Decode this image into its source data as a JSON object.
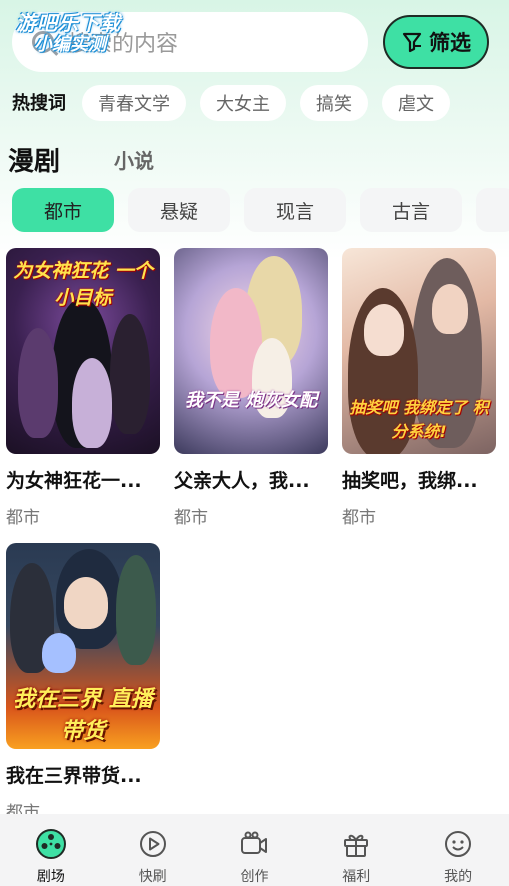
{
  "watermark": {
    "line1": "游吧乐下载",
    "line2": "小编实测"
  },
  "search": {
    "placeholder": "搜索的内容"
  },
  "filter_button": {
    "label": "筛选"
  },
  "hot_search": {
    "label": "热搜词",
    "chips": [
      "青春文学",
      "大女主",
      "搞笑",
      "虐文"
    ]
  },
  "tabs": {
    "active": "漫剧",
    "other": "小说"
  },
  "categories": [
    "都市",
    "悬疑",
    "现言",
    "古言"
  ],
  "cards": [
    {
      "title": "为女神狂花一...",
      "tag": "都市",
      "cover_text": "为女神狂花 一个小目标"
    },
    {
      "title": "父亲大人，我...",
      "tag": "都市",
      "cover_text": "我不是 炮灰女配"
    },
    {
      "title": "抽奖吧，我绑...",
      "tag": "都市",
      "cover_text": "抽奖吧 我绑定了 积分系统!"
    },
    {
      "title": "我在三界带货...",
      "tag": "都市",
      "cover_text": "我在三界 直播带货"
    }
  ],
  "bottom_nav": [
    {
      "label": "剧场",
      "icon": "film-reel-icon"
    },
    {
      "label": "快刷",
      "icon": "play-circle-icon"
    },
    {
      "label": "创作",
      "icon": "video-camera-icon"
    },
    {
      "label": "福利",
      "icon": "gift-icon"
    },
    {
      "label": "我的",
      "icon": "smiley-face-icon"
    }
  ],
  "colors": {
    "accent": "#3ee0a4",
    "dark": "#1f2b25"
  }
}
